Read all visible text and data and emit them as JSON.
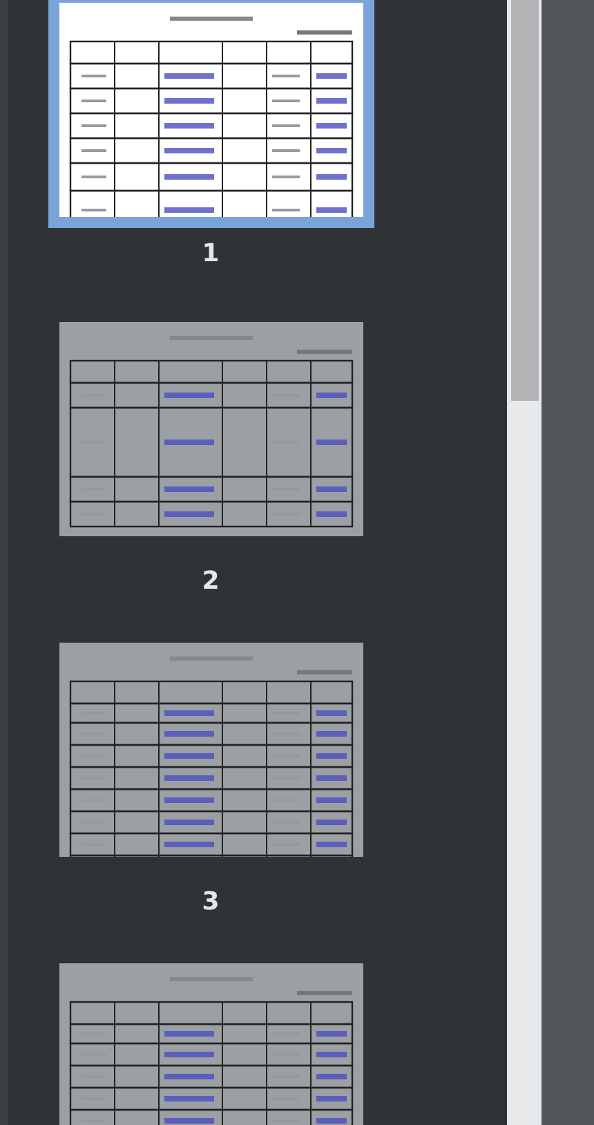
{
  "pages": [
    {
      "label": "1",
      "selected": true
    },
    {
      "label": "2",
      "selected": false
    },
    {
      "label": "3",
      "selected": false
    },
    {
      "selected": false
    }
  ]
}
